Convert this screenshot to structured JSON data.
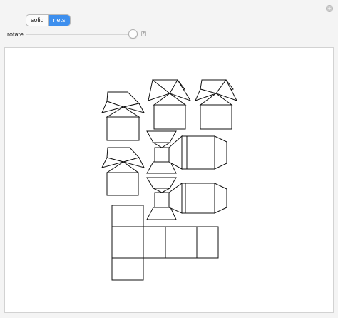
{
  "controls": {
    "view_toggle": {
      "options": [
        "solid",
        "nets"
      ],
      "selected": "nets"
    },
    "rotate": {
      "label": "rotate",
      "value_fraction": 0.95
    }
  },
  "icons": {
    "options": "plus-circle-icon",
    "slider_step": "plus-icon"
  },
  "colors": {
    "selected_toggle": "#3d8fee",
    "panel_background": "#f4f4f4",
    "canvas_background": "#ffffff",
    "line": "#111111"
  }
}
